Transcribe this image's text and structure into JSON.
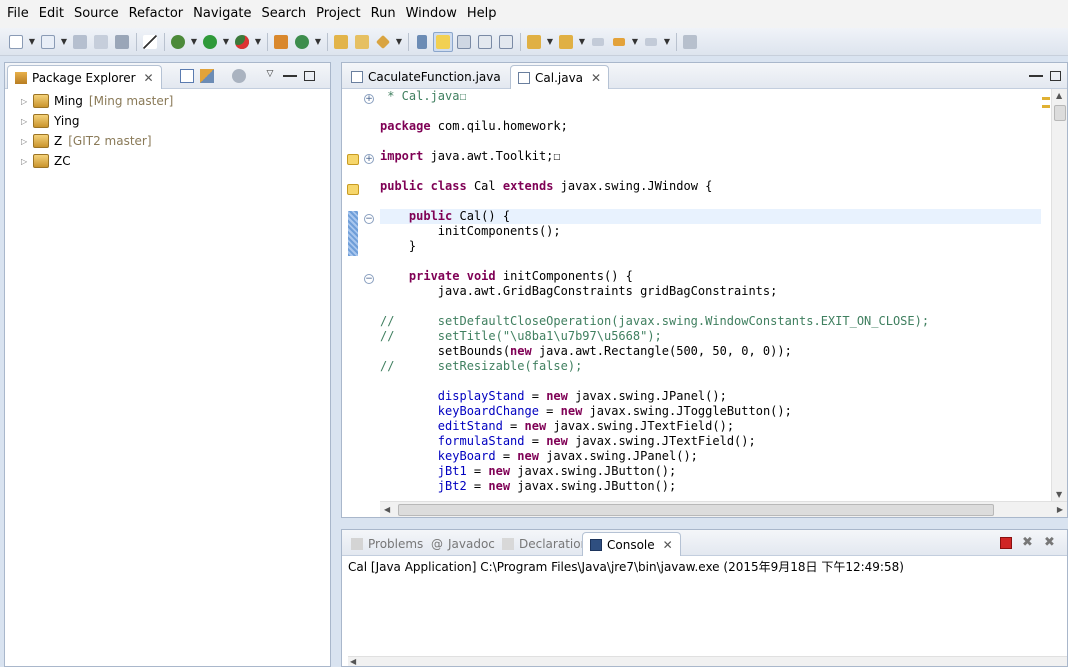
{
  "menu": [
    "File",
    "Edit",
    "Source",
    "Refactor",
    "Navigate",
    "Search",
    "Project",
    "Run",
    "Window",
    "Help"
  ],
  "package_explorer": {
    "title": "Package Explorer",
    "projects": [
      {
        "name": "Ming",
        "branch": "[Ming master]"
      },
      {
        "name": "Ying",
        "branch": ""
      },
      {
        "name": "Z",
        "branch": "[GIT2 master]"
      },
      {
        "name": "ZC",
        "branch": ""
      }
    ]
  },
  "editor": {
    "tabs": [
      {
        "label": "CaculateFunction.java",
        "selected": false
      },
      {
        "label": "Cal.java",
        "selected": true
      }
    ],
    "code_lines": [
      " * Cal.java☐",
      "",
      "package com.qilu.homework;",
      "",
      "import java.awt.Toolkit;☐",
      "",
      "public class Cal extends javax.swing.JWindow {",
      "",
      "    public Cal() {",
      "        initComponents();",
      "    }",
      "",
      "    private void initComponents() {",
      "        java.awt.GridBagConstraints gridBagConstraints;",
      "",
      "//      setDefaultCloseOperation(javax.swing.WindowConstants.EXIT_ON_CLOSE);",
      "//      setTitle(\"\\u8ba1\\u7b97\\u5668\");",
      "        setBounds(new java.awt.Rectangle(500, 50, 0, 0));",
      "//      setResizable(false);",
      "",
      "        displayStand = new javax.swing.JPanel();",
      "        keyBoardChange = new javax.swing.JToggleButton();",
      "        editStand = new javax.swing.JTextField();",
      "        formulaStand = new javax.swing.JTextField();",
      "        keyBoard = new javax.swing.JPanel();",
      "        jBt1 = new javax.swing.JButton();",
      "        jBt2 = new javax.swing.JButton();"
    ]
  },
  "bottom": {
    "tabs": [
      "Problems",
      "Javadoc",
      "Declaration",
      "Console"
    ],
    "selected": "Console",
    "console_line": "Cal [Java Application] C:\\Program Files\\Java\\jre7\\bin\\javaw.exe (2015年9月18日 下午12:49:58)"
  },
  "colors": {
    "keyword": "#7f0055",
    "comment": "#3f7f5f",
    "string": "#2a00ff",
    "field": "#0000c0"
  }
}
